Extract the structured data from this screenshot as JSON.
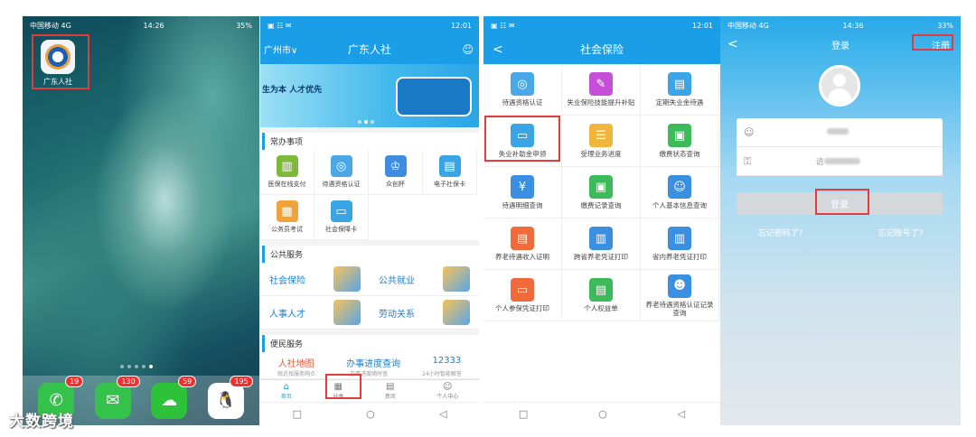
{
  "screen1": {
    "status": {
      "carrier": "中国移动 4G",
      "time": "14:26",
      "battery": "35%"
    },
    "app_label": "广东人社",
    "dock": [
      {
        "icon": "phone-icon",
        "badge": "19",
        "color": "#35c24a",
        "glyph": "✆"
      },
      {
        "icon": "messages-icon",
        "badge": "130",
        "color": "#35c24a",
        "glyph": "✉"
      },
      {
        "icon": "wechat-icon",
        "badge": "59",
        "color": "#2dc23a",
        "glyph": "☁"
      },
      {
        "icon": "qq-icon",
        "badge": "195",
        "color": "#ffffff",
        "glyph": "🐧"
      }
    ],
    "watermark": "大数跨境"
  },
  "screen2": {
    "status": {
      "left": "▣ ☷ ✉",
      "time": "12:01"
    },
    "city": "广州市∨",
    "title": "广东人社",
    "banner_slogan": "生为本 人才优先",
    "common_title": "常办事项",
    "common_items": [
      {
        "label": "医保在线支付",
        "color": "#7dba3a",
        "glyph": "▥"
      },
      {
        "label": "待遇资格认证",
        "color": "#4aa8e8",
        "glyph": "◎"
      },
      {
        "label": "众创杯",
        "color": "#3f8de0",
        "glyph": "♔"
      },
      {
        "label": "电子社保卡",
        "color": "#3aa5e6",
        "glyph": "▤"
      },
      {
        "label": "公务员考试",
        "color": "#f0a33a",
        "glyph": "▦"
      },
      {
        "label": "社会保障卡",
        "color": "#3aa5e6",
        "glyph": "▭"
      }
    ],
    "public_title": "公共服务",
    "public_items": [
      "社会保险",
      "公共就业",
      "人事人才",
      "劳动关系"
    ],
    "convenience_title": "便民服务",
    "quick_links": [
      "人社地图",
      "办事进度查询",
      "12333"
    ],
    "quick_subs": [
      "就近找服务网点",
      "办事进度随时查",
      "24小时智能解答"
    ],
    "tabs": [
      {
        "label": "首页",
        "glyph": "⌂"
      },
      {
        "label": "分类",
        "glyph": "▦"
      },
      {
        "label": "资讯",
        "glyph": "▤"
      },
      {
        "label": "个人中心",
        "glyph": "☺"
      }
    ],
    "sysnav": [
      "□",
      "○",
      "◁"
    ]
  },
  "screen3": {
    "status": {
      "left": "▣ ☷ ✉",
      "time": "12:01"
    },
    "back": "<",
    "title": "社会保险",
    "items": [
      {
        "label": "待遇资格认证",
        "color": "#4aa8e8",
        "glyph": "◎"
      },
      {
        "label": "失业保险技能提升补贴",
        "color": "#c64fd8",
        "glyph": "✎"
      },
      {
        "label": "定期失业金待遇",
        "color": "#3aa5e6",
        "glyph": "▤"
      },
      {
        "label": "失业补助金申领",
        "color": "#3aa5e6",
        "glyph": "▭"
      },
      {
        "label": "受理业务进度",
        "color": "#f0b53a",
        "glyph": "☰"
      },
      {
        "label": "缴费状态查询",
        "color": "#3dbb5a",
        "glyph": "▣"
      },
      {
        "label": "待遇明细查询",
        "color": "#3a8fe0",
        "glyph": "¥"
      },
      {
        "label": "缴费记录查询",
        "color": "#3dbb5a",
        "glyph": "▣"
      },
      {
        "label": "个人基本信息查询",
        "color": "#3a8fe0",
        "glyph": "☺"
      },
      {
        "label": "养老待遇收入证明",
        "color": "#f06a3a",
        "glyph": "▤"
      },
      {
        "label": "跨省养老凭证打印",
        "color": "#3a8fe0",
        "glyph": "▥"
      },
      {
        "label": "省内养老凭证打印",
        "color": "#3a8fe0",
        "glyph": "▥"
      },
      {
        "label": "个人参保凭证打印",
        "color": "#f06a3a",
        "glyph": "▭"
      },
      {
        "label": "个人权益单",
        "color": "#3dbb5a",
        "glyph": "▤"
      },
      {
        "label": "养老待遇资格认证记录查询",
        "color": "#3a8fe0",
        "glyph": "☻"
      }
    ],
    "sysnav": [
      "□",
      "○",
      "◁"
    ]
  },
  "screen4": {
    "status": {
      "carrier": "中国移动 4G",
      "time": "14:36",
      "battery": "33%"
    },
    "back": "<",
    "title": "登录",
    "register": "注册",
    "password_placeholder": "请",
    "login_button": "登录",
    "forgot_password": "忘记密码了?",
    "forgot_account": "忘记账号了?"
  }
}
